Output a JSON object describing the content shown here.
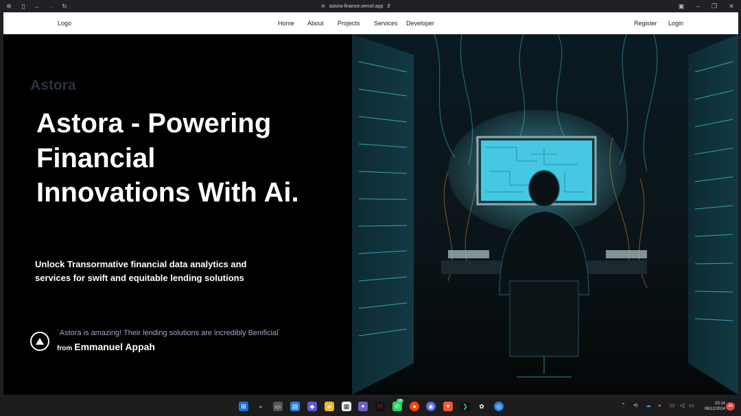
{
  "browser": {
    "url": "astora-finance.vercel.app"
  },
  "nav": {
    "logo": "Logo",
    "links": [
      "Home",
      "About",
      "Projects",
      "Services",
      "Developer"
    ],
    "register": "Register",
    "login": "Login"
  },
  "hero": {
    "brand": "Astora",
    "title": "Astora - Powering Financial Innovations With Ai.",
    "subtitle": "Unlock Transormative financial data analytics and services for swift and equitable lending solutions",
    "testimonial": {
      "quote": "`Astora is amazing! Their lending solutions are incredibly Benificial`",
      "from_label": "from",
      "author": "Emmanuel Appah"
    },
    "image_icon": "server-room-hacker-illustration"
  },
  "taskbar": {
    "whatsapp_badge": "18",
    "notification_badge": "44",
    "time": "23:14",
    "date": "06/12/2024"
  },
  "colors": {
    "background": "#000000",
    "nav_bg": "#ffffff",
    "brand": "#2b3242",
    "quote": "#a7a3c8",
    "accent_cyan": "#4fe3ff"
  }
}
